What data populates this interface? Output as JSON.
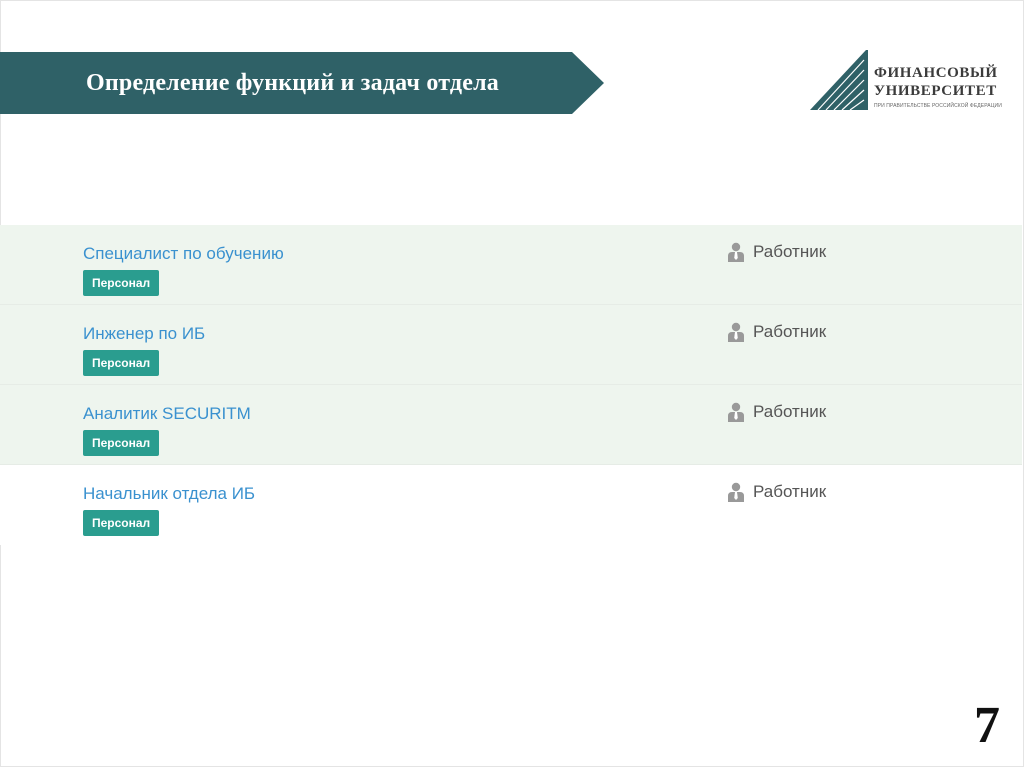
{
  "slide": {
    "title": "Определение функций и задач отдела",
    "page_number": "7"
  },
  "logo": {
    "line1": "ФИНАНСОВЫЙ",
    "line2": "УНИВЕРСИТЕТ",
    "line3": "ПРИ ПРАВИТЕЛЬСТВЕ РОССИЙСКОЙ ФЕДЕРАЦИИ"
  },
  "roles": [
    {
      "name": "Специалист по обучению",
      "tag": "Персонал",
      "type": "Работник",
      "icon": "person-icon"
    },
    {
      "name": "Инженер по ИБ",
      "tag": "Персонал",
      "type": "Работник",
      "icon": "person-icon"
    },
    {
      "name": "Аналитик SECURITM",
      "tag": "Персонал",
      "type": "Работник",
      "icon": "person-icon"
    },
    {
      "name": "Начальник отдела ИБ",
      "tag": "Персонал",
      "type": "Работник",
      "icon": "person-icon"
    }
  ],
  "colors": {
    "banner": "#2f6167",
    "link": "#3a91cf",
    "tag": "#2a9d8f",
    "row_highlight": "#eef5ee"
  }
}
